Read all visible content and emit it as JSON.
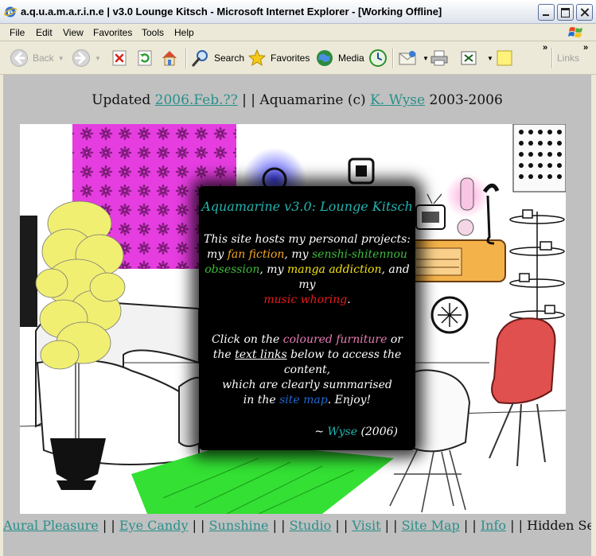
{
  "window": {
    "title": "a.q.u.a.m.a.r.i.n.e | v3.0 Lounge Kitsch - Microsoft Internet Explorer - [Working Offline]"
  },
  "menu": [
    "File",
    "Edit",
    "View",
    "Favorites",
    "Tools",
    "Help"
  ],
  "toolbar": {
    "back": "Back",
    "search": "Search",
    "favorites": "Favorites",
    "media": "Media",
    "links": "Links"
  },
  "page": {
    "updated_prefix": "Updated",
    "updated_date": "2006.Feb.??",
    "updated_mid": "| | Aquamarine (c)",
    "author": "K. Wyse",
    "years": "2003-2006"
  },
  "panel": {
    "title": "Aquamarine v3.0: Lounge Kitsch",
    "intro_1": "This site hosts my personal projects:",
    "my": "my",
    "fan_fiction": "fan fiction",
    "comma_my": ", my",
    "senshi": "senshi-shitennou",
    "obsession": "obsession",
    "comma_my2": ", my",
    "manga": "manga addiction",
    "and_my": ", and my",
    "music": "music whoring",
    "period": ".",
    "click_on": "Click on the",
    "coloured_furniture": "coloured furniture",
    "or": "or",
    "the": "the",
    "text_links": "text links",
    "below": "below to access the content,",
    "which": "which are clearly summarised",
    "in_the": "in the",
    "site_map": "site map",
    "enjoy": ". Enjoy!",
    "sig_dash": "~",
    "sig_name": "Wyse",
    "sig_year": "(2006)"
  },
  "nav": {
    "sep": "| |",
    "aural": "Aural Pleasure",
    "eye": "Eye Candy",
    "sunshine": "Sunshine",
    "studio": "Studio",
    "visit": "Visit",
    "sitemap": "Site Map",
    "info": "Info",
    "hidden": "Hidden Secrets"
  },
  "colors": {
    "link": "#2a8f8a",
    "teal": "#23b3ad",
    "orange": "#f5a623",
    "green": "#3dbb3d",
    "yellow": "#f2e012",
    "red": "#e8191b",
    "pink": "#e77bb5",
    "blue": "#1e6ad1"
  },
  "icons": [
    "ie-icon",
    "minimize-icon",
    "maximize-icon",
    "close-icon",
    "windows-logo-icon",
    "back-arrow-icon",
    "forward-arrow-icon",
    "stop-icon",
    "refresh-icon",
    "home-icon",
    "search-icon",
    "favorites-star-icon",
    "media-icon",
    "history-icon",
    "mail-icon",
    "print-icon",
    "edit-icon",
    "discuss-icon"
  ]
}
